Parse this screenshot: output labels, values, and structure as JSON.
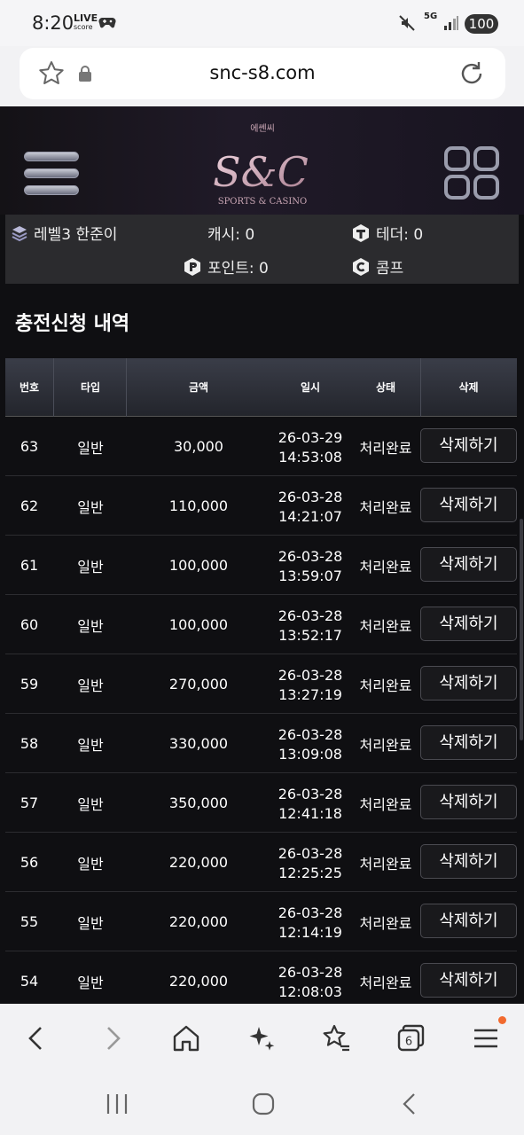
{
  "status_bar": {
    "time": "8:20",
    "live_label": "LIVE",
    "live_sub": "score",
    "network": "5G",
    "battery": "100"
  },
  "browser": {
    "url": "snc-s8.com"
  },
  "site": {
    "logo_korean": "에쎈씨",
    "logo_mark": "S&C",
    "logo_sub": "SPORTS & CASINO",
    "user": "레벨3 한준이",
    "cash": "캐시: 0",
    "tether": "테더: 0",
    "points": "포인트: 0",
    "comp": "콤프"
  },
  "section_title": "충전신청 내역",
  "table": {
    "headers": [
      "번호",
      "타입",
      "금액",
      "일시",
      "상태",
      "삭제"
    ],
    "delete_label": "삭제하기",
    "rows": [
      {
        "no": "63",
        "type": "일반",
        "amount": "30,000",
        "date": "26-03-29",
        "time": "14:53:08",
        "status": "처리완료"
      },
      {
        "no": "62",
        "type": "일반",
        "amount": "110,000",
        "date": "26-03-28",
        "time": "14:21:07",
        "status": "처리완료"
      },
      {
        "no": "61",
        "type": "일반",
        "amount": "100,000",
        "date": "26-03-28",
        "time": "13:59:07",
        "status": "처리완료"
      },
      {
        "no": "60",
        "type": "일반",
        "amount": "100,000",
        "date": "26-03-28",
        "time": "13:52:17",
        "status": "처리완료"
      },
      {
        "no": "59",
        "type": "일반",
        "amount": "270,000",
        "date": "26-03-28",
        "time": "13:27:19",
        "status": "처리완료"
      },
      {
        "no": "58",
        "type": "일반",
        "amount": "330,000",
        "date": "26-03-28",
        "time": "13:09:08",
        "status": "처리완료"
      },
      {
        "no": "57",
        "type": "일반",
        "amount": "350,000",
        "date": "26-03-28",
        "time": "12:41:18",
        "status": "처리완료"
      },
      {
        "no": "56",
        "type": "일반",
        "amount": "220,000",
        "date": "26-03-28",
        "time": "12:25:25",
        "status": "처리완료"
      },
      {
        "no": "55",
        "type": "일반",
        "amount": "220,000",
        "date": "26-03-28",
        "time": "12:14:19",
        "status": "처리완료"
      },
      {
        "no": "54",
        "type": "일반",
        "amount": "220,000",
        "date": "26-03-28",
        "time": "12:08:03",
        "status": "처리완료"
      }
    ]
  },
  "bottom_bar": {
    "icons": [
      "back-icon",
      "forward-icon",
      "home-icon",
      "sparkle-icon",
      "bookmarks-icon",
      "tabs-icon",
      "menu-icon"
    ],
    "tab_count": "6"
  },
  "nav_bar": {
    "icons": [
      "recent-apps-icon",
      "home-nav-icon",
      "back-nav-icon"
    ]
  }
}
